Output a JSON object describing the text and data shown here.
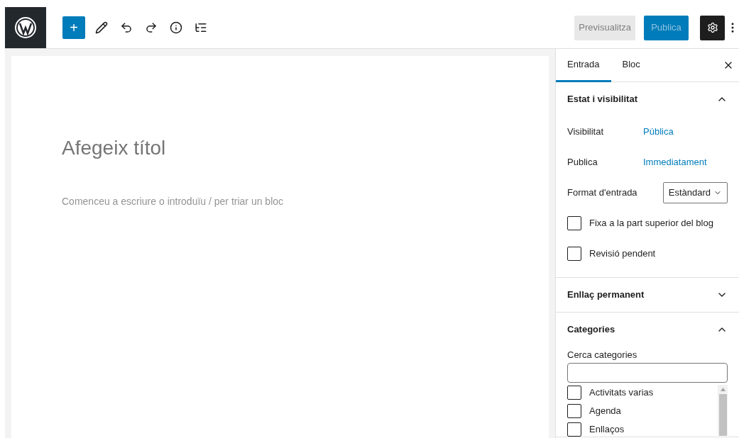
{
  "toolbar": {
    "inserter": "+",
    "preview": "Previsualitza",
    "publish": "Publica"
  },
  "editor": {
    "title_placeholder": "Afegeix títol",
    "body_placeholder": "Comenceu a escriure o introduïu / per triar un bloc"
  },
  "sidebar": {
    "tabs": [
      {
        "label": "Entrada",
        "selected": true
      },
      {
        "label": "Bloc",
        "selected": false
      }
    ],
    "panels": [
      {
        "title": "Estat i visibilitat",
        "expanded": true,
        "rows": [
          {
            "kind": "link",
            "label": "Visibilitat",
            "value": "Pública"
          },
          {
            "kind": "link",
            "label": "Publica",
            "value": "Immediatament"
          },
          {
            "kind": "select",
            "label": "Format d'entrada",
            "value": "Estàndard"
          },
          {
            "kind": "checkbox",
            "label": "Fixa a la part superior del blog",
            "checked": false
          },
          {
            "kind": "checkbox",
            "label": "Revisió pendent",
            "checked": false
          }
        ]
      },
      {
        "title": "Enllaç permanent",
        "expanded": false
      },
      {
        "title": "Categories",
        "expanded": true,
        "search_label": "Cerca categories",
        "categories": [
          {
            "label": "Activitats varias",
            "checked": false
          },
          {
            "label": "Agenda",
            "checked": false
          },
          {
            "label": "Enllaços",
            "checked": false
          }
        ]
      }
    ]
  }
}
